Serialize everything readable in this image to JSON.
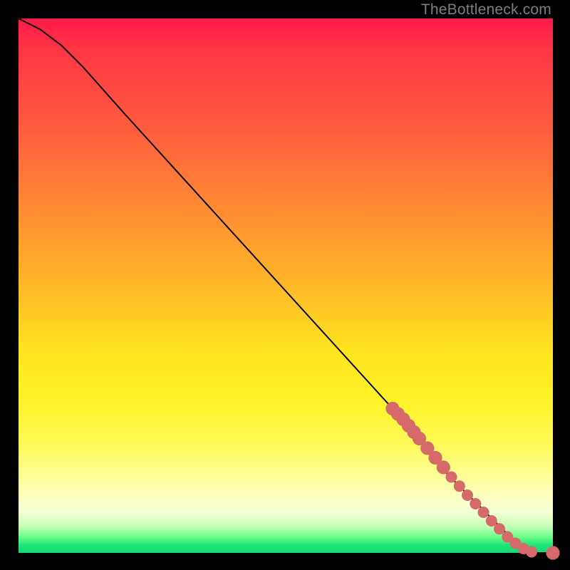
{
  "watermark": "TheBottleneck.com",
  "chart_data": {
    "type": "line",
    "title": "",
    "xlabel": "",
    "ylabel": "",
    "xlim": [
      0,
      100
    ],
    "ylim": [
      0,
      100
    ],
    "grid": false,
    "legend": false,
    "series": [
      {
        "name": "curve",
        "x": [
          0,
          4,
          8,
          12,
          20,
          30,
          40,
          50,
          60,
          70,
          76,
          80,
          84,
          88,
          92,
          95,
          97,
          100
        ],
        "y": [
          100,
          98,
          95,
          91,
          82,
          71,
          60,
          49,
          38,
          27,
          20,
          15,
          11,
          7,
          3,
          1,
          0,
          0
        ]
      }
    ],
    "markers": {
      "name": "highlighted-points",
      "color": "#d66a6a",
      "points": [
        {
          "x": 70,
          "y": 27,
          "r": 1.2
        },
        {
          "x": 71,
          "y": 26,
          "r": 1.2
        },
        {
          "x": 72,
          "y": 25,
          "r": 1.2
        },
        {
          "x": 73,
          "y": 23.8,
          "r": 1.2
        },
        {
          "x": 74,
          "y": 22.6,
          "r": 1.2
        },
        {
          "x": 75,
          "y": 21.4,
          "r": 1.2
        },
        {
          "x": 76.5,
          "y": 19.6,
          "r": 1.2
        },
        {
          "x": 78,
          "y": 17.8,
          "r": 1.2
        },
        {
          "x": 79.5,
          "y": 16,
          "r": 1.2
        },
        {
          "x": 81,
          "y": 14.2,
          "r": 1.0
        },
        {
          "x": 82.5,
          "y": 12.5,
          "r": 1.0
        },
        {
          "x": 84,
          "y": 10.8,
          "r": 1.0
        },
        {
          "x": 85.5,
          "y": 9.2,
          "r": 1.0
        },
        {
          "x": 87,
          "y": 7.6,
          "r": 1.0
        },
        {
          "x": 88.5,
          "y": 6,
          "r": 1.0
        },
        {
          "x": 90,
          "y": 4.5,
          "r": 1.0
        },
        {
          "x": 91.5,
          "y": 3,
          "r": 1.0
        },
        {
          "x": 93,
          "y": 1.8,
          "r": 1.0
        },
        {
          "x": 94.5,
          "y": 0.8,
          "r": 1.0
        },
        {
          "x": 96,
          "y": 0.2,
          "r": 1.0
        },
        {
          "x": 100,
          "y": 0,
          "r": 1.2
        }
      ]
    }
  }
}
